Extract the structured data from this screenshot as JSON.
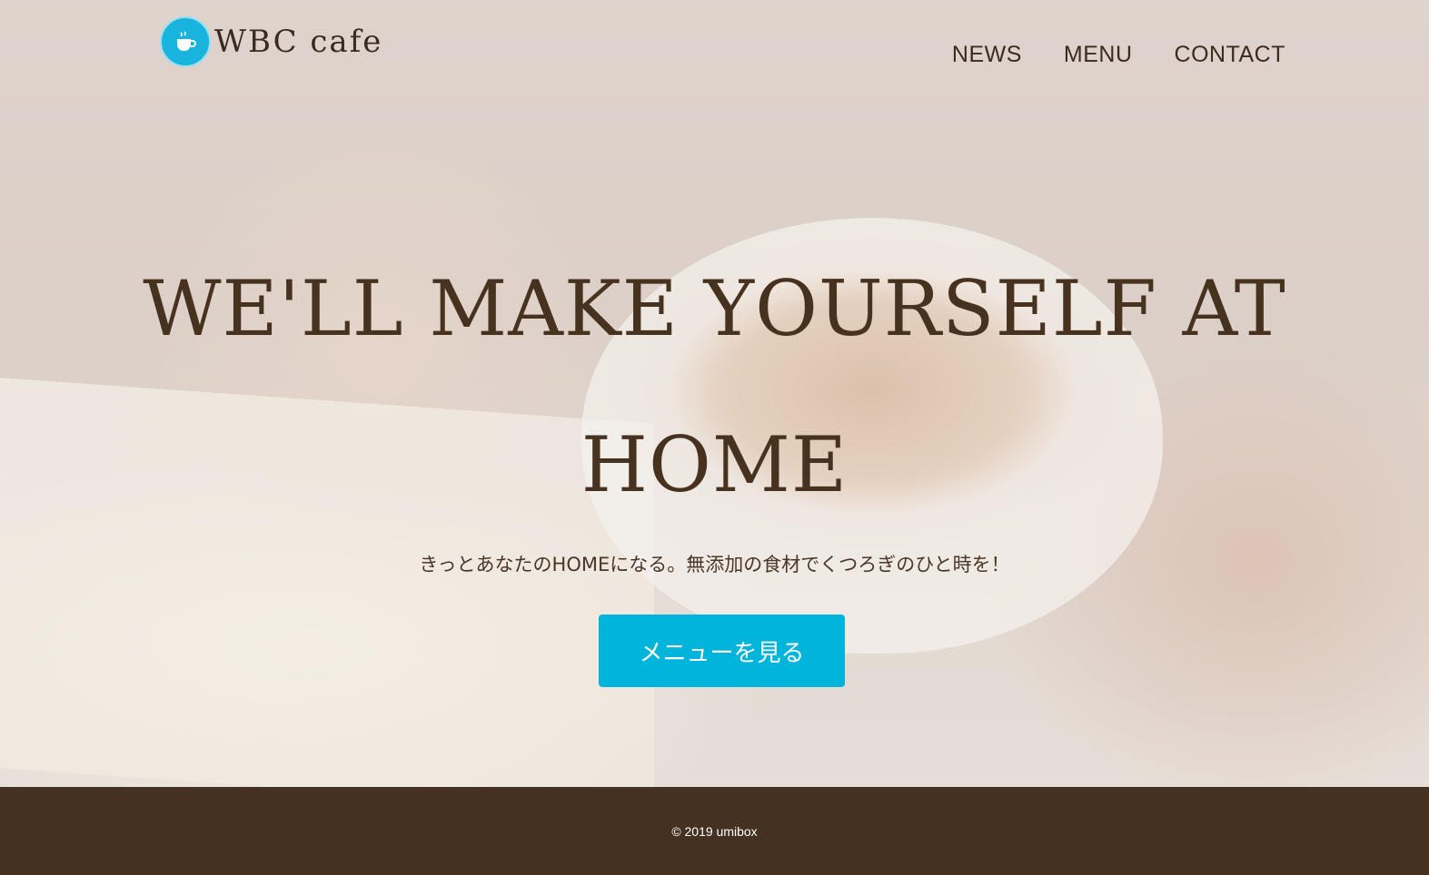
{
  "header": {
    "logo_text": "WBC cafe",
    "nav": [
      {
        "label": "NEWS"
      },
      {
        "label": "MENU"
      },
      {
        "label": "CONTACT"
      }
    ]
  },
  "hero": {
    "headline": "WE'LL MAKE YOURSELF AT HOME",
    "tagline": "きっとあなたのHOMEになる。無添加の食材でくつろぎのひと時を！",
    "cta_label": "メニューを見る"
  },
  "footer": {
    "copyright": "© 2019 umibox"
  },
  "colors": {
    "accent": "#00b4dc",
    "brand_brown": "#453122",
    "text_brown": "#47311f"
  },
  "icons": {
    "logo": "coffee-cup-icon"
  }
}
